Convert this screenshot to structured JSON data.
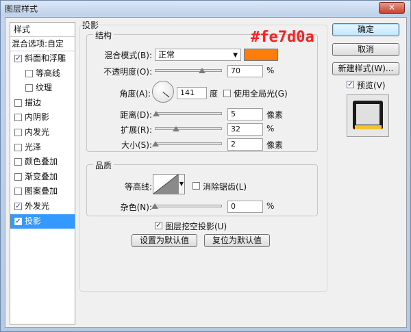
{
  "window": {
    "title": "图层样式",
    "close_glyph": "✕"
  },
  "styles_panel": {
    "header": "样式",
    "blend_options": "混合选项:自定",
    "items": [
      {
        "label": "斜面和浮雕",
        "checked": true,
        "indent": false,
        "selected": false
      },
      {
        "label": "等高线",
        "checked": false,
        "indent": true,
        "selected": false
      },
      {
        "label": "纹理",
        "checked": false,
        "indent": true,
        "selected": false
      },
      {
        "label": "描边",
        "checked": false,
        "indent": false,
        "selected": false
      },
      {
        "label": "内阴影",
        "checked": false,
        "indent": false,
        "selected": false
      },
      {
        "label": "内发光",
        "checked": false,
        "indent": false,
        "selected": false
      },
      {
        "label": "光泽",
        "checked": false,
        "indent": false,
        "selected": false
      },
      {
        "label": "颜色叠加",
        "checked": false,
        "indent": false,
        "selected": false
      },
      {
        "label": "渐变叠加",
        "checked": false,
        "indent": false,
        "selected": false
      },
      {
        "label": "图案叠加",
        "checked": false,
        "indent": false,
        "selected": false
      },
      {
        "label": "外发光",
        "checked": true,
        "indent": false,
        "selected": false
      },
      {
        "label": "投影",
        "checked": true,
        "indent": false,
        "selected": true
      }
    ]
  },
  "drop_shadow": {
    "section_title": "投影",
    "structure": {
      "title": "结构",
      "blend_mode_label": "混合模式(B):",
      "blend_mode_value": "正常",
      "shadow_color": "#fe7d0a",
      "opacity_label": "不透明度(O):",
      "opacity_value": "70",
      "opacity_unit": "%",
      "opacity_fraction": 0.7,
      "angle_label": "角度(A):",
      "angle_value": "141",
      "angle_unit": "度",
      "global_light_label": "使用全局光(G)",
      "global_light_checked": false,
      "distance_label": "距离(D):",
      "distance_value": "5",
      "distance_unit": "像素",
      "distance_fraction": 0.02,
      "spread_label": "扩展(R):",
      "spread_value": "32",
      "spread_unit": "%",
      "spread_fraction": 0.32,
      "size_label": "大小(S):",
      "size_value": "2",
      "size_unit": "像素",
      "size_fraction": 0.01
    },
    "quality": {
      "title": "品质",
      "contour_label": "等高线:",
      "anti_alias_label": "消除锯齿(L)",
      "anti_alias_checked": false,
      "noise_label": "杂色(N):",
      "noise_value": "0",
      "noise_unit": "%",
      "noise_fraction": 0.0
    },
    "knockout_label": "图层挖空投影(U)",
    "knockout_checked": true,
    "make_default_label": "设置为默认值",
    "reset_default_label": "复位为默认值"
  },
  "buttons": {
    "ok": "确定",
    "cancel": "取消",
    "new_style": "新建样式(W)...",
    "preview_label": "预览(V)",
    "preview_checked": true
  },
  "annotation": {
    "text": "#fe7d0a",
    "color": "#ff1f1f"
  }
}
